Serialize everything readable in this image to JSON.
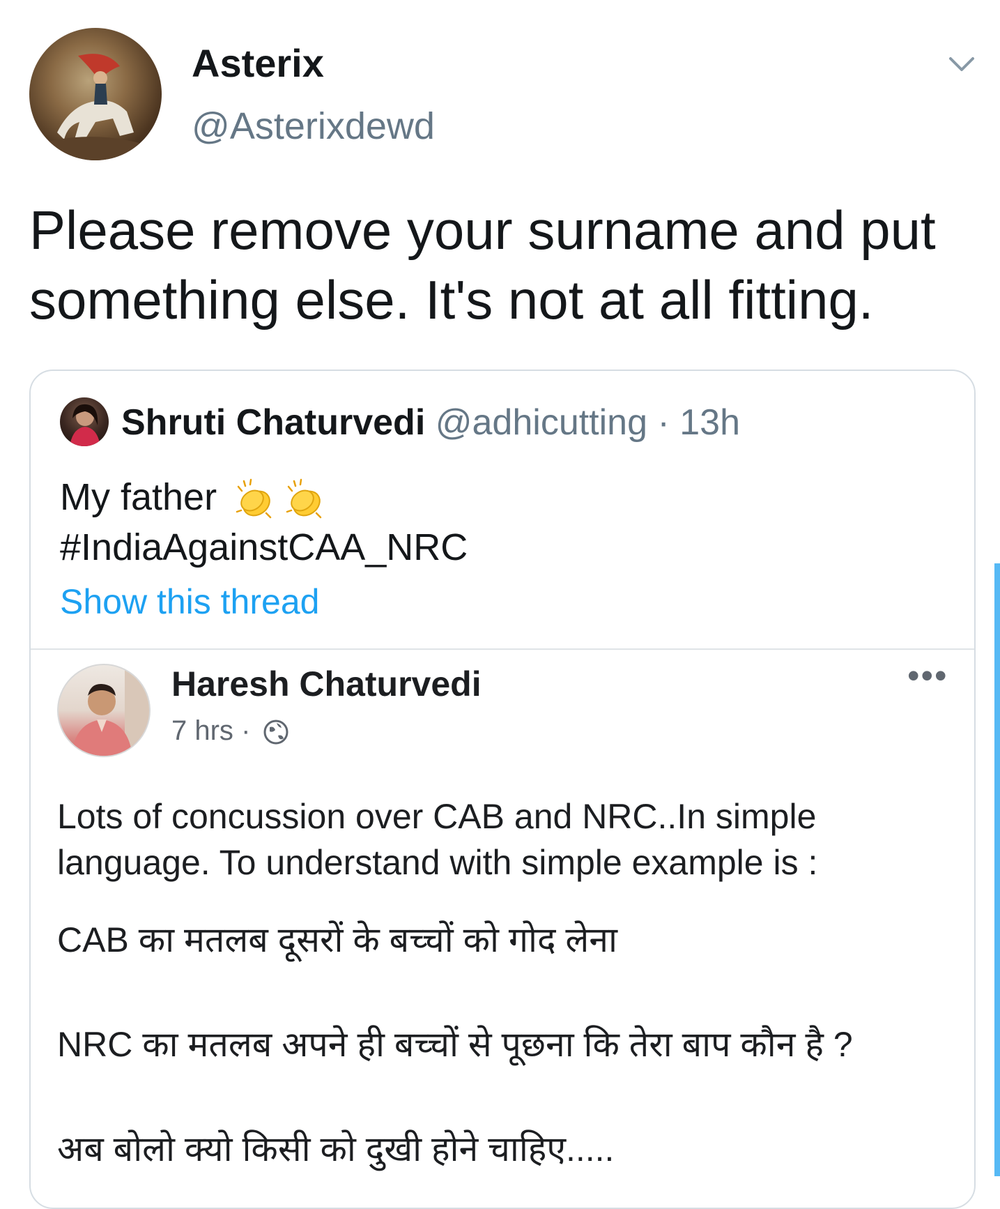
{
  "tweet": {
    "author": {
      "display_name": "Asterix",
      "handle": "@Asterixdewd"
    },
    "text": "Please remove your surname and put something else. It's not at all fitting.",
    "menu_icon": "chevron-down-icon"
  },
  "quoted_tweet": {
    "author_name": "Shruti Chaturvedi",
    "author_handle": "@adhicutting",
    "separator": "·",
    "time": "13h",
    "line1": "My father",
    "emoji": [
      "clapping-hands-icon",
      "clapping-hands-icon"
    ],
    "hashtag": "#IndiaAgainstCAA_NRC",
    "show_thread": "Show this thread"
  },
  "embedded_post": {
    "author_name": "Haresh Chaturvedi",
    "time": "7 hrs",
    "dot": "·",
    "privacy_icon": "globe-icon",
    "more": "•••",
    "para1_line1": "Lots of concussion over CAB and NRC..In simple",
    "para1_line2": "language. To understand with simple example is :",
    "para2": "CAB का मतलब दूसरों के बच्चों को गोद लेना",
    "para3": "NRC का मतलब अपने ही बच्चों से पूछना कि तेरा बाप कौन है ?",
    "para4": "अब बोलो क्यो किसी को दुखी होने चाहिए....."
  },
  "colors": {
    "link": "#1da1f2",
    "secondary_text": "#657786",
    "border": "#d6dde3"
  }
}
